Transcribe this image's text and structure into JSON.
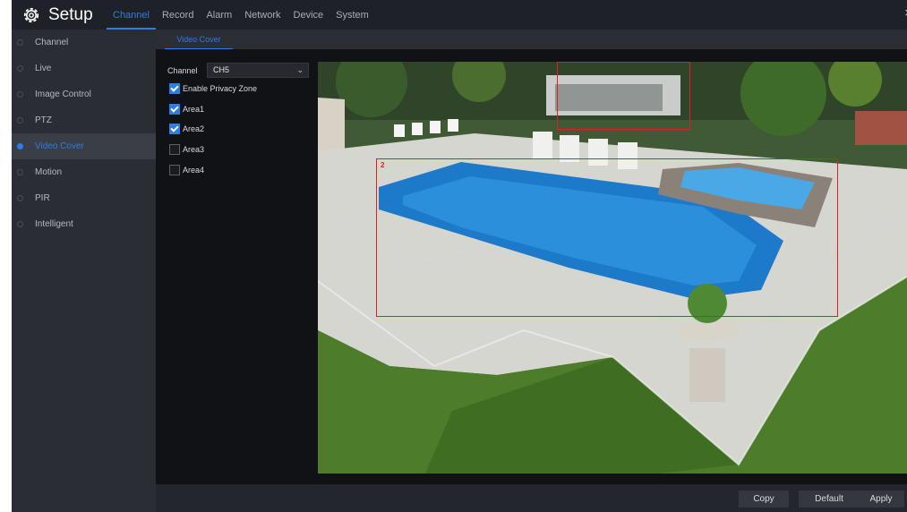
{
  "header": {
    "title": "Setup",
    "tabs": [
      {
        "label": "Channel",
        "active": true
      },
      {
        "label": "Record",
        "active": false
      },
      {
        "label": "Alarm",
        "active": false
      },
      {
        "label": "Network",
        "active": false
      },
      {
        "label": "Device",
        "active": false
      },
      {
        "label": "System",
        "active": false
      }
    ],
    "close": "×"
  },
  "sidebar": {
    "items": [
      {
        "label": "Channel",
        "active": false
      },
      {
        "label": "Live",
        "active": false
      },
      {
        "label": "Image Control",
        "active": false
      },
      {
        "label": "PTZ",
        "active": false
      },
      {
        "label": "Video Cover",
        "active": true
      },
      {
        "label": "Motion",
        "active": false
      },
      {
        "label": "PIR",
        "active": false
      },
      {
        "label": "Intelligent",
        "active": false
      }
    ]
  },
  "subtab": {
    "label": "Video Cover"
  },
  "settings": {
    "channel_label": "Channel",
    "channel_value": "CH5",
    "checks": [
      {
        "label": "Enable Privacy Zone",
        "checked": true
      },
      {
        "label": "Area1",
        "checked": true
      },
      {
        "label": "Area2",
        "checked": true
      },
      {
        "label": "Area3",
        "checked": false
      },
      {
        "label": "Area4",
        "checked": false
      }
    ]
  },
  "preview": {
    "zones": [
      {
        "label": "1",
        "visible_label": false
      },
      {
        "label": "2",
        "visible_label": true
      }
    ]
  },
  "footer": {
    "copy": "Copy",
    "default": "Default",
    "apply": "Apply"
  },
  "colors": {
    "accent": "#2e7de0",
    "zone": "#e02020"
  }
}
